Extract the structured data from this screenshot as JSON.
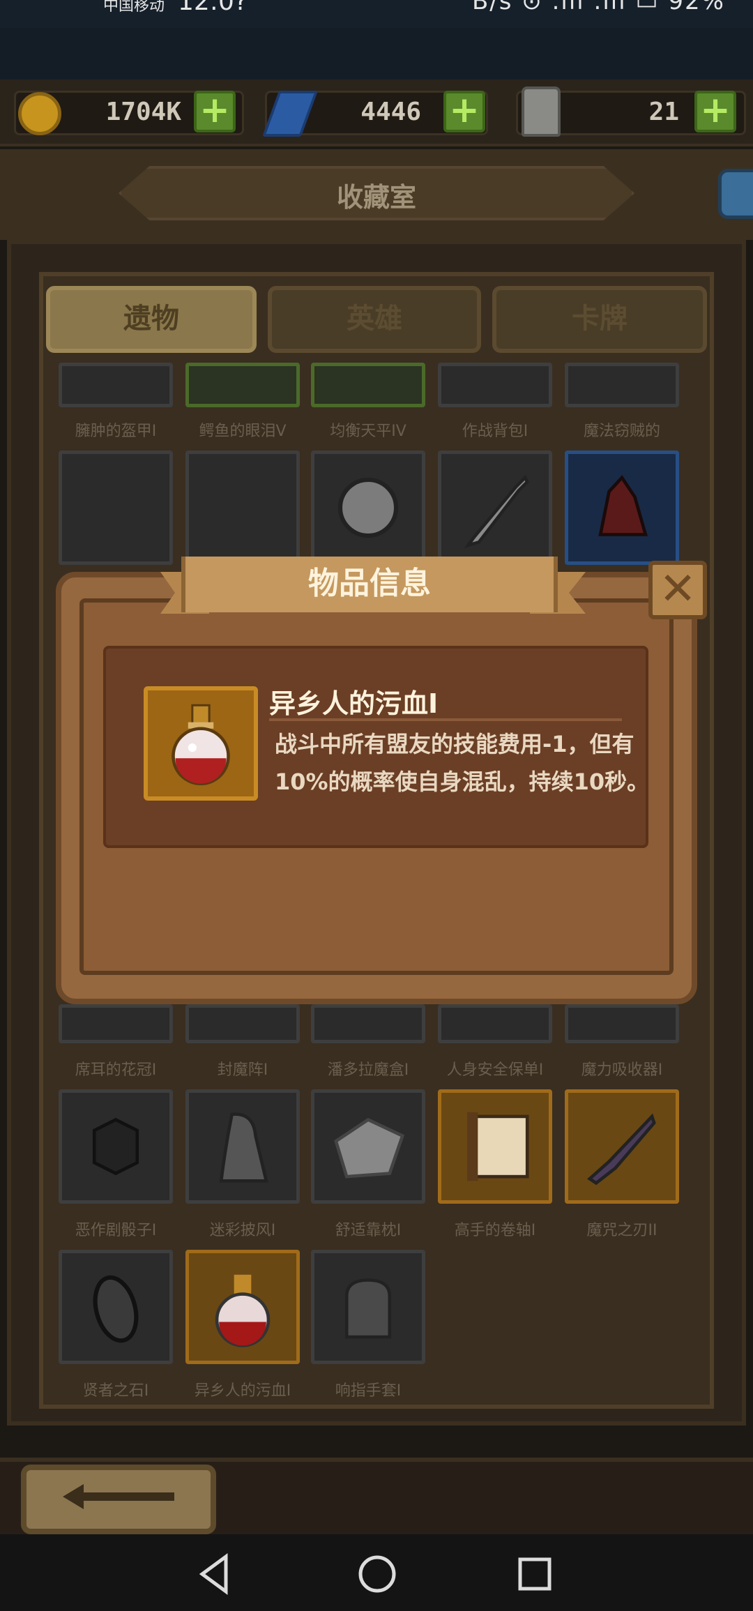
{
  "status_bar": {
    "carrier": "中国移动",
    "time": "12:0?",
    "right_text": "B/s  ⊙  .ıll  .ıll  ▭  92%"
  },
  "resources": {
    "gold": "1704K",
    "gems": "4446",
    "potions": "21",
    "add_symbol": "+"
  },
  "header": {
    "title": "收藏室"
  },
  "tabs": [
    {
      "label": "遗物",
      "active": true
    },
    {
      "label": "英雄",
      "active": false
    },
    {
      "label": "卡牌",
      "active": false
    }
  ],
  "grid": {
    "row1_labels": [
      "臃肿的盔甲I",
      "鳄鱼的眼泪V",
      "均衡天平IV",
      "作战背包I",
      "魔法窃贼的"
    ],
    "row_bottom_labels_1": [
      "席耳的花冠I",
      "封魔阵I",
      "潘多拉魔盒I",
      "人身安全保单I",
      "魔力吸收器I"
    ],
    "row_bottom_labels_2": [
      "恶作剧骰子I",
      "迷彩披风I",
      "舒适靠枕I",
      "高手的卷轴I",
      "魔咒之刃II"
    ],
    "row_bottom_labels_3": [
      "贤者之石I",
      "异乡人的污血I",
      "响指手套I"
    ]
  },
  "modal": {
    "title": "物品信息",
    "close_symbol": "✕",
    "item_name": "异乡人的污血I",
    "item_description": "战斗中所有盟友的技能费用-1，但有10%的概率使自身混乱，持续10秒。"
  }
}
